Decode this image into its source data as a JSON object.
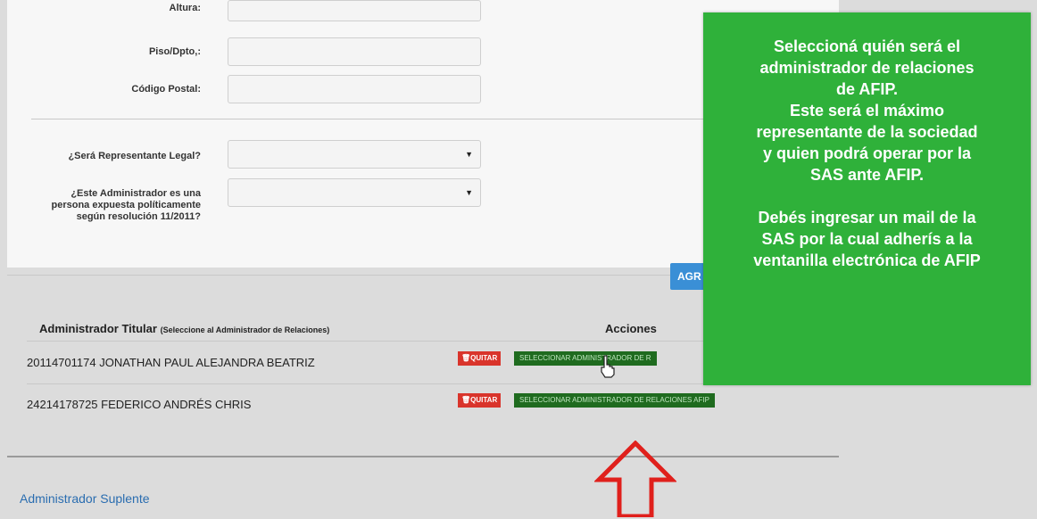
{
  "form": {
    "altura_label": "Altura:",
    "piso_label": "Piso/Dpto,:",
    "cp_label": "Código Postal:",
    "representante_label": "¿Será Representante Legal?",
    "expuesta_label_1": "¿Este Administrador es una",
    "expuesta_label_2": "persona expuesta políticamente",
    "expuesta_label_3": "según resolución 11/2011?"
  },
  "agregar_button": "AGR",
  "table": {
    "header_main": "Administrador Titular",
    "header_sub": "(Seleccione al Administrador de Relaciones)",
    "header_actions": "Acciones",
    "quitar_label": "QUITAR",
    "rows": [
      {
        "name": "20114701174 JONATHAN PAUL ALEJANDRA BEATRIZ",
        "select_label": "SELECCIONAR ADMINISTRADOR DE R"
      },
      {
        "name": "24214178725 FEDERICO ANDRÉS CHRIS",
        "select_label": "SELECCIONAR ADMINISTRADOR DE RELACIONES AFIP"
      }
    ]
  },
  "suplente_title": "Administrador Suplente",
  "callout": {
    "line1": "Seleccioná quién será el",
    "line2": "administrador de relaciones",
    "line3": "de AFIP.",
    "line4": "Este será el máximo",
    "line5": "representante de la sociedad",
    "line6": "y quien podrá operar por la",
    "line7": "SAS ante AFIP.",
    "line8": "Debés ingresar un mail de la",
    "line9": "SAS por la cual adherís a la",
    "line10": "ventanilla electrónica de AFIP"
  },
  "colors": {
    "callout_bg": "#2fb13a",
    "quitar_bg": "#d9342b",
    "select_bg": "#1f6b1f",
    "link_blue": "#2a6db0",
    "arrow_red": "#e0201c"
  },
  "icons": [
    "pointer-hand-icon",
    "up-arrow-icon"
  ]
}
